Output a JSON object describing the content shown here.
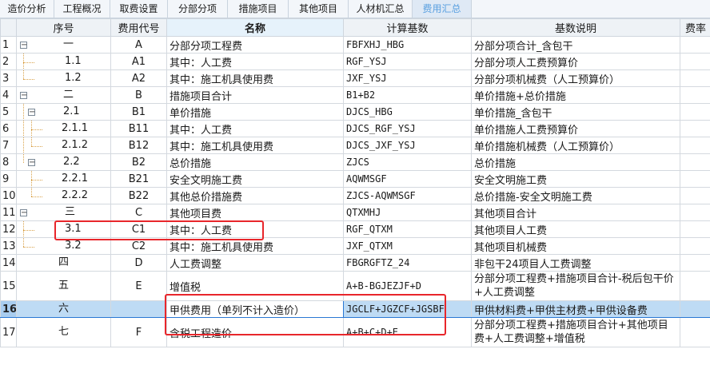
{
  "tabs": [
    {
      "label": "造价分析",
      "active": false
    },
    {
      "label": "工程概况",
      "active": false
    },
    {
      "label": "取费设置",
      "active": false
    },
    {
      "label": "分部分项",
      "active": false
    },
    {
      "label": "措施项目",
      "active": false
    },
    {
      "label": "其他项目",
      "active": false
    },
    {
      "label": "人材机汇总",
      "active": false
    },
    {
      "label": "费用汇总",
      "active": true
    }
  ],
  "columns": {
    "seq": "序号",
    "code": "费用代号",
    "name": "名称",
    "base": "计算基数",
    "desc": "基数说明",
    "rate": "费率"
  },
  "rows": [
    {
      "num": "1",
      "seq": "一",
      "code": "A",
      "name": "分部分项工程费",
      "base": "FBFXHJ_HBG",
      "desc": "分部分项合计_含包干"
    },
    {
      "num": "2",
      "seq": "1.1",
      "code": "A1",
      "name": "其中：人工费",
      "base": "RGF_YSJ",
      "desc": "分部分项人工费预算价"
    },
    {
      "num": "3",
      "seq": "1.2",
      "code": "A2",
      "name": "其中：施工机具使用费",
      "base": "JXF_YSJ",
      "desc": "分部分项机械费（人工预算价）"
    },
    {
      "num": "4",
      "seq": "二",
      "code": "B",
      "name": "措施项目合计",
      "base": "B1+B2",
      "desc": "单价措施+总价措施"
    },
    {
      "num": "5",
      "seq": "2.1",
      "code": "B1",
      "name": "单价措施",
      "base": "DJCS_HBG",
      "desc": "单价措施_含包干"
    },
    {
      "num": "6",
      "seq": "2.1.1",
      "code": "B11",
      "name": "其中：人工费",
      "base": "DJCS_RGF_YSJ",
      "desc": "单价措施人工费预算价"
    },
    {
      "num": "7",
      "seq": "2.1.2",
      "code": "B12",
      "name": "其中：施工机具使用费",
      "base": "DJCS_JXF_YSJ",
      "desc": "单价措施机械费（人工预算价）"
    },
    {
      "num": "8",
      "seq": "2.2",
      "code": "B2",
      "name": "总价措施",
      "base": "ZJCS",
      "desc": "总价措施"
    },
    {
      "num": "9",
      "seq": "2.2.1",
      "code": "B21",
      "name": "安全文明施工费",
      "base": "AQWMSGF",
      "desc": "安全文明施工费"
    },
    {
      "num": "10",
      "seq": "2.2.2",
      "code": "B22",
      "name": "其他总价措施费",
      "base": "ZJCS-AQWMSGF",
      "desc": "总价措施-安全文明施工费"
    },
    {
      "num": "11",
      "seq": "三",
      "code": "C",
      "name": "其他项目费",
      "base": "QTXMHJ",
      "desc": "其他项目合计"
    },
    {
      "num": "12",
      "seq": "3.1",
      "code": "C1",
      "name": "其中：人工费",
      "base": "RGF_QTXM",
      "desc": "其他项目人工费"
    },
    {
      "num": "13",
      "seq": "3.2",
      "code": "C2",
      "name": "其中：施工机具使用费",
      "base": "JXF_QTXM",
      "desc": "其他项目机械费"
    },
    {
      "num": "14",
      "seq": "四",
      "code": "D",
      "name": "人工费调整",
      "base": "FBGRGFTZ_24",
      "desc": "非包干24项目人工费调整"
    },
    {
      "num": "15",
      "seq": "五",
      "code": "E",
      "name": "增值税",
      "base": "A+B-BGJEZJF+D",
      "desc": "分部分项工程费+措施项目合计-税后包干价+人工费调整"
    },
    {
      "num": "16",
      "seq": "六",
      "code": "",
      "name": "甲供费用（单列不计入造价）",
      "base": "JGCLF+JGZCF+JGSBF",
      "desc": "甲供材料费+甲供主材费+甲供设备费"
    },
    {
      "num": "17",
      "seq": "七",
      "code": "F",
      "name": "含税工程造价",
      "base": "A+B+C+D+E",
      "desc": "分部分项工程费+措施项目合计+其他项目费+人工费调整+增值税"
    }
  ],
  "selected_row": "16",
  "tree_toggle_symbol": "−",
  "colors": {
    "tab_active_text": "#5aa0e0",
    "selected_row": "#bedbf4",
    "highlight_box": "#e8262b"
  }
}
